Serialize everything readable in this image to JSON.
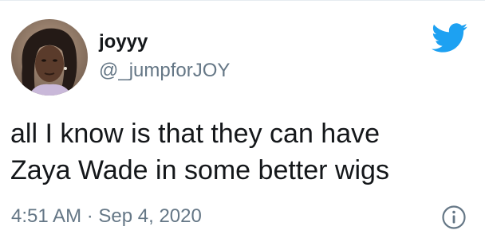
{
  "tweet": {
    "display_name": "joyyy",
    "handle": "@_jumpforJOY",
    "text": "all I know is that they can have\nZaya Wade in some better wigs",
    "time": "4:51 AM",
    "separator": "·",
    "date": "Sep 4, 2020"
  },
  "icons": {
    "avatar": "profile-photo",
    "brand": "twitter-bird-icon",
    "info": "info-icon"
  },
  "colors": {
    "twitter_blue": "#1da1f2",
    "text_primary": "#14171a",
    "text_secondary": "#657786"
  }
}
